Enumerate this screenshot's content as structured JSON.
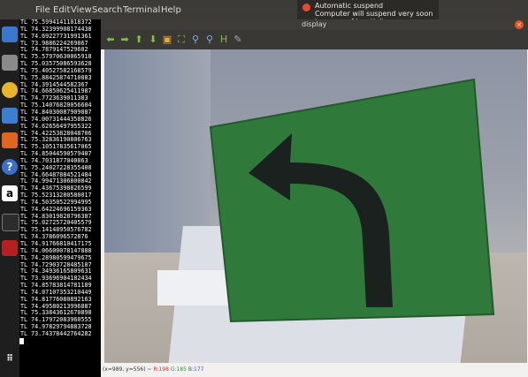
{
  "menubar": {
    "items": [
      "File",
      "Edit",
      "View",
      "Search",
      "Terminal",
      "Help"
    ]
  },
  "notification": {
    "title": "Automatic suspend",
    "message": "Computer will suspend very soon because of inactivity."
  },
  "terminal": {
    "lines": [
      "TL 75.59941411018372",
      "TL 74.32399908174438",
      "TL 74.69227731991361",
      "TL 73.9886224269867",
      "TL 74.7879147529602",
      "TL 75.57970630065918",
      "TL 75.03575086593628",
      "TL 75.40527582168579",
      "TL 75.88425874710083",
      "TL 74.3914544582367",
      "TL 74.66850625411987",
      "TL 74.7723639011383",
      "TL 75.14076820056604",
      "TL 74.84030087909087",
      "TL 74.00731444358826",
      "TL 74.62656497955322",
      "TL 74.42253828048706",
      "TL 75.32836190806763",
      "TL 75.10517835617065",
      "TL 74.85044590579407",
      "TL 74.7031877040863",
      "TL 75.24027228355408",
      "TL 74.66487884521484",
      "TL 74.99471306800842",
      "TL 74.43675398826599",
      "TL 75.52313280580017",
      "TL 74.50350522994995",
      "TL 74.64224696159363",
      "TL 74.83019828796387",
      "TL 75.02725720405579",
      "TL 75.14148950576782",
      "TL 74.3786096572876",
      "TL 74.91766810417175",
      "TL 74.06600078147888",
      "TL 74.28980599479675",
      "TL 74.72903728485107",
      "TL 74.34936165809631",
      "TL 73.93696904182434",
      "TL 74.85783814781189",
      "TL 74.07107353210449",
      "TL 74.81776080892163",
      "TL 74.49580213996887",
      "TL 75.33843612670898",
      "TL 74.17972083960555",
      "TL 74.97829794883728",
      "TL 73.74378442764282"
    ]
  },
  "display_window": {
    "title": "display",
    "status": {
      "coords": "(x=989, y=556) ~",
      "r": "R:198",
      "g": "G:185",
      "b": "B:177"
    }
  },
  "colors": {
    "sign_green": "#2f7a3a",
    "arrow_black": "#1b211f",
    "accent_orange": "#e95420"
  },
  "icons": [
    "ubuntu-icon",
    "chromium-icon",
    "files-icon",
    "rhythmbox-icon",
    "writer-icon",
    "software-center-icon",
    "help-icon",
    "amazon-icon",
    "terminal-icon",
    "unknown-app-icon",
    "apps-grid-icon"
  ]
}
